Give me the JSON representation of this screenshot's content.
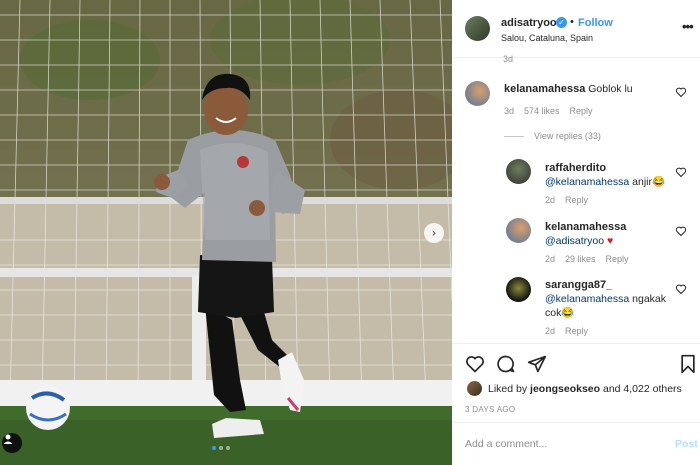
{
  "post": {
    "username": "adisatryoo",
    "follow_label": "Follow",
    "location": "Salou, Cataluna, Spain",
    "more_label": "•••",
    "faded_time": "3d"
  },
  "comments": [
    {
      "username": "kelanamahessa",
      "text": "Goblok lu",
      "time": "3d",
      "likes": "574 likes",
      "reply": "Reply"
    }
  ],
  "view_replies": "View replies (33)",
  "replies": [
    {
      "username": "raffaherdito",
      "mention": "@kelanamahessa",
      "text": " anjir😂",
      "time": "2d",
      "reply": "Reply"
    },
    {
      "username": "kelanamahessa",
      "mention": "@adisatryoo",
      "text": " ♥",
      "time": "2d",
      "likes": "29 likes",
      "reply": "Reply"
    },
    {
      "username": "sarangga87_",
      "mention": "@kelanamahessa",
      "text": " ngakak",
      "text2": "cok😂",
      "time": "2d",
      "reply": "Reply"
    }
  ],
  "likes": {
    "prefix": "Liked by ",
    "user": "jeongseokseo",
    "suffix": " and 4,022 others"
  },
  "time_ago": "3 DAYS AGO",
  "add_comment": {
    "placeholder": "Add a comment...",
    "post_label": "Post"
  },
  "icons": {
    "like": "heart-icon",
    "comment": "comment-bubble-icon",
    "share": "paper-plane-icon",
    "save": "bookmark-icon",
    "next": "chevron-right-icon",
    "tag": "user-tag-icon"
  },
  "colors": {
    "accent": "#3897f0",
    "mention": "#00376b",
    "secondary_text": "#8e8e8e"
  }
}
